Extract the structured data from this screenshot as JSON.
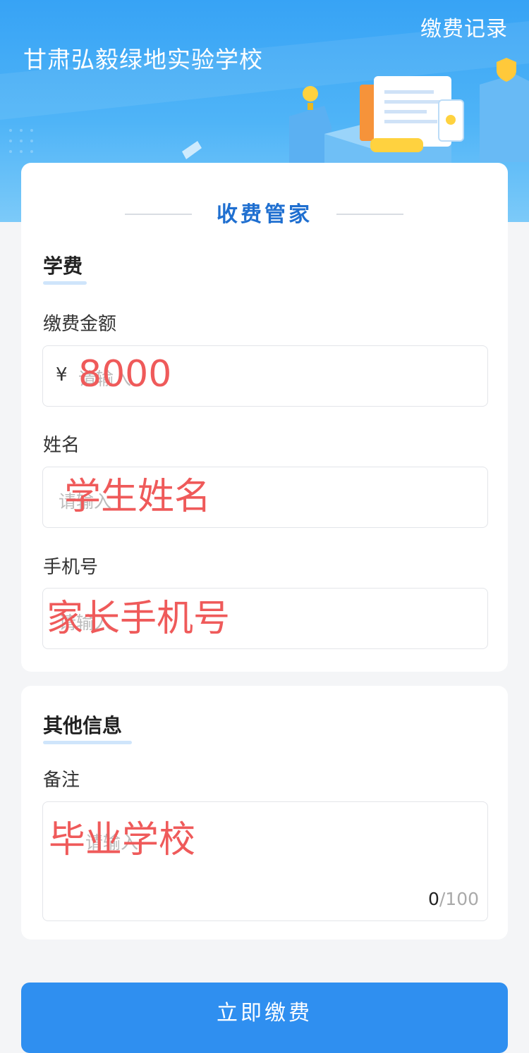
{
  "header": {
    "school_name": "甘肃弘毅绿地实验学校",
    "record_link": "缴费记录"
  },
  "card_title": "收费管家",
  "tuition_section": {
    "title": "学费",
    "amount": {
      "label": "缴费金额",
      "currency": "¥",
      "placeholder": "请输入",
      "value": "8000"
    },
    "name": {
      "label": "姓名",
      "placeholder": "请输入",
      "value": "学生姓名"
    },
    "phone": {
      "label": "手机号",
      "placeholder": "请输入",
      "value": "家长手机号"
    }
  },
  "other_section": {
    "title": "其他信息",
    "remark": {
      "label": "备注",
      "placeholder": "请输入",
      "value": "毕业学校",
      "count": "0",
      "max": "/100"
    }
  },
  "submit_label": "立即缴费",
  "colors": {
    "accent": "#2f8ff0",
    "title_blue": "#1f6fd0",
    "overlay_red": "#ef5a5a"
  }
}
